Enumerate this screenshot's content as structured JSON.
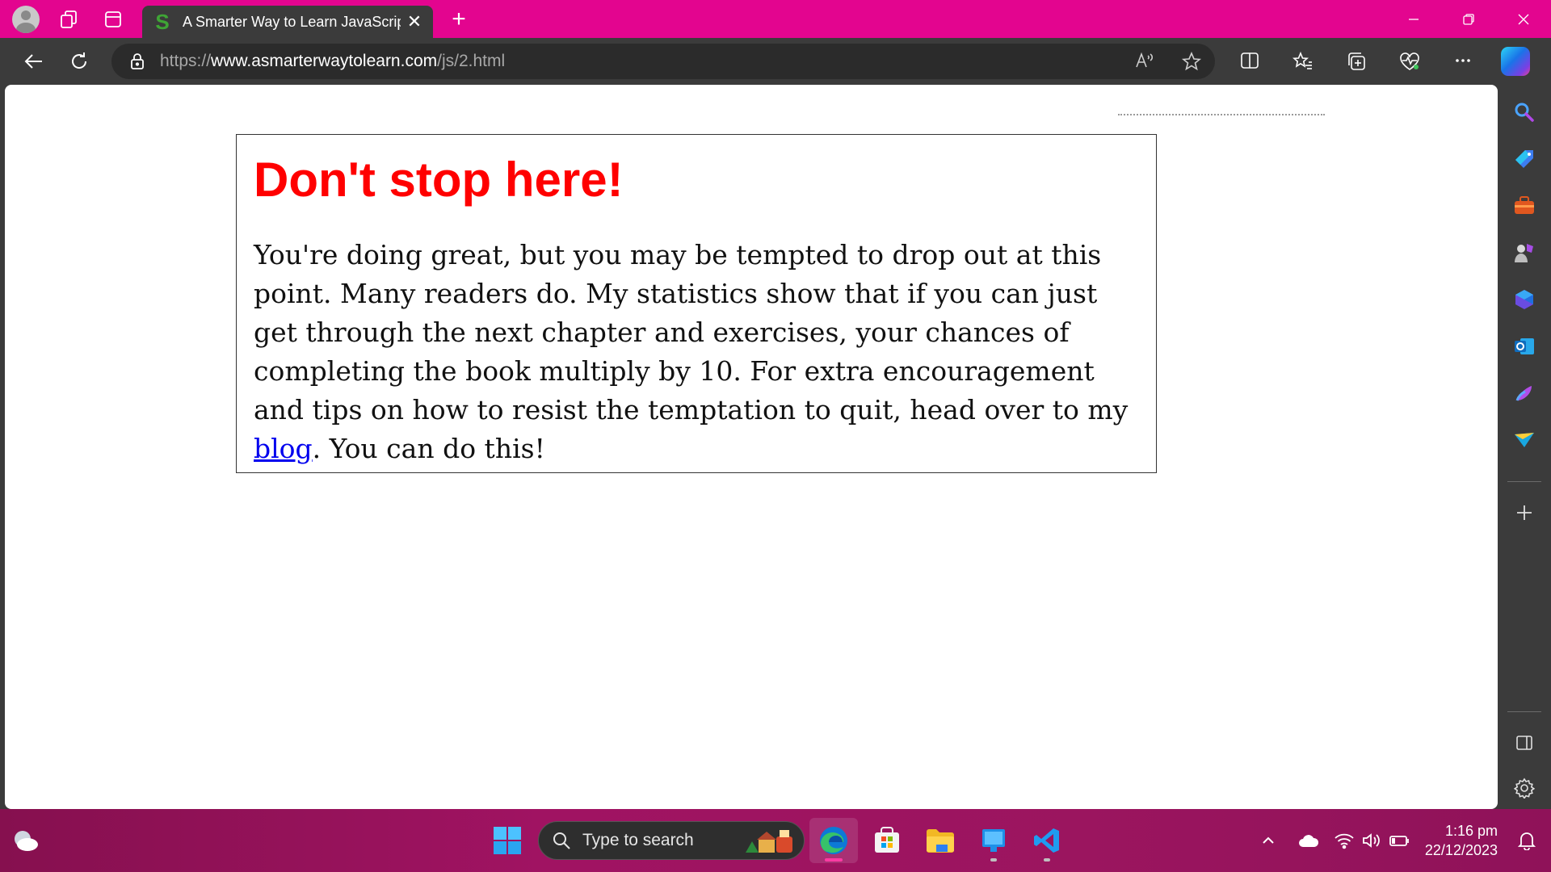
{
  "browser": {
    "tab": {
      "favicon_letter": "S",
      "title": "A Smarter Way to Learn JavaScript"
    },
    "address": {
      "scheme": "https://",
      "host": "www.asmarterwaytolearn.com",
      "path": "/js/2.html"
    }
  },
  "page": {
    "heading": "Don't stop here!",
    "paragraph_before_link": "You're doing great, but you may be tempted to drop out at this point. Many readers do. My statistics show that if you can just get through the next chapter and exercises, your chances of completing the book multiply by 10. For extra encouragement and tips on how to resist the temptation to quit, head over to my ",
    "link_text": "blog",
    "paragraph_after_link": ". You can do this!",
    "heading_color": "#ff0000",
    "link_color": "#0000ee"
  },
  "sidebar": {
    "items": [
      "search-icon",
      "shopping-tag-icon",
      "tools-briefcase-icon",
      "games-icon",
      "microsoft-365-icon",
      "outlook-icon",
      "designer-icon",
      "send-icon",
      "add-icon",
      "sidebar-toggle-icon",
      "settings-icon"
    ]
  },
  "taskbar": {
    "search_placeholder": "Type to search",
    "time": "1:16 pm",
    "date": "22/12/2023"
  },
  "colors": {
    "tabstrip": "#e3058f",
    "chrome": "#3b3b3b",
    "taskbar": "#9b155f"
  }
}
